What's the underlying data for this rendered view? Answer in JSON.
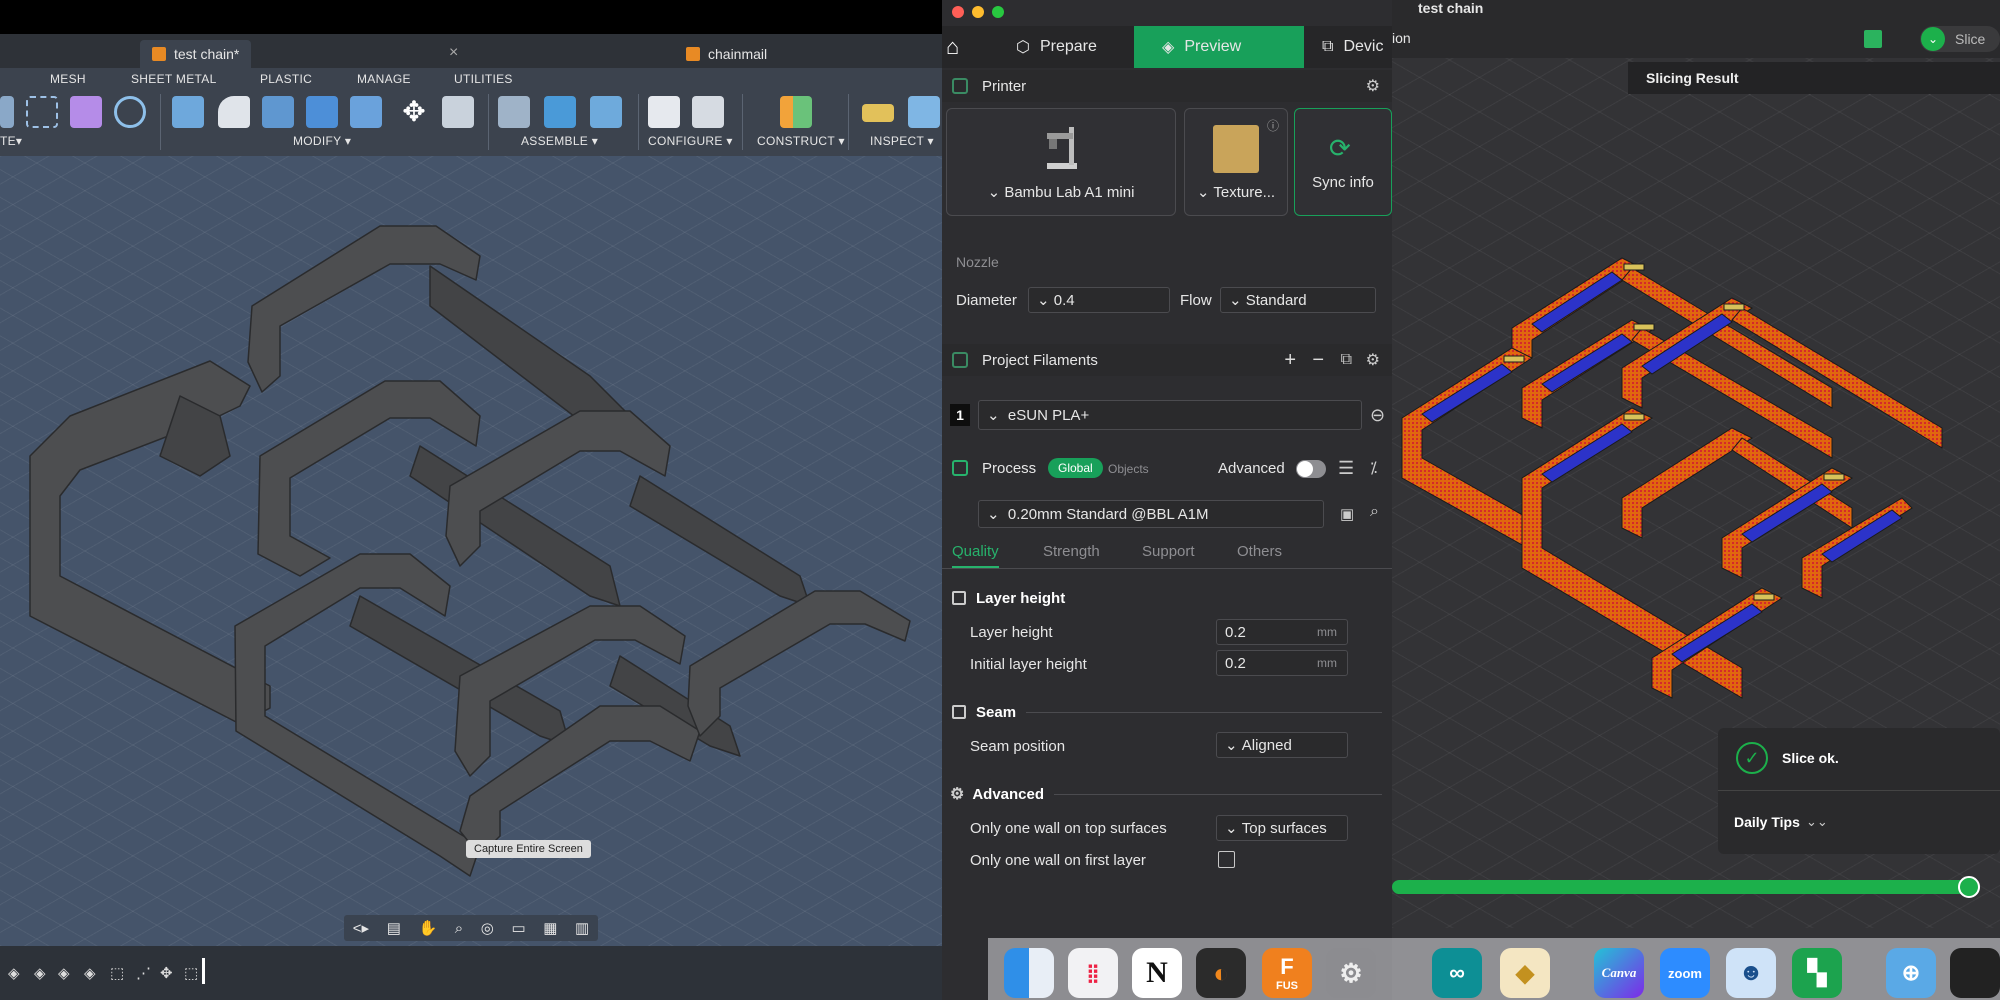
{
  "fusion": {
    "tabs": [
      {
        "label": "test chain*"
      },
      {
        "label": "chainmail"
      }
    ],
    "tab_close": "×",
    "menu": [
      "MESH",
      "SHEET METAL",
      "PLASTIC",
      "MANAGE",
      "UTILITIES"
    ],
    "groups": [
      "TE▾",
      "MODIFY ▾",
      "ASSEMBLE ▾",
      "CONFIGURE ▾",
      "CONSTRUCT ▾",
      "INSPECT ▾"
    ],
    "tooltip": "Capture Entire Screen",
    "nav_icons": [
      "<▸",
      "▤",
      "✋",
      "⌕",
      "◎",
      "▭",
      "▦",
      "▥"
    ],
    "colors": {
      "cube": "#e88a24",
      "model": "#4d4e50",
      "viewport": "#45546a"
    }
  },
  "bambu": {
    "tabs": {
      "prepare": "Prepare",
      "preview": "Preview",
      "device": "Devic"
    },
    "printer": {
      "title": "Printer",
      "model": "Bambu Lab A1 mini",
      "plate": "Texture...",
      "sync": "Sync info"
    },
    "nozzle": {
      "title": "Nozzle",
      "diameter_label": "Diameter",
      "diameter_value": "0.4",
      "flow_label": "Flow",
      "flow_value": "Standard"
    },
    "filaments": {
      "title": "Project Filaments",
      "index": "1",
      "name": "eSUN PLA+"
    },
    "process": {
      "title": "Process",
      "global": "Global",
      "objects": "Objects",
      "advanced": "Advanced",
      "preset": "0.20mm Standard @BBL A1M",
      "tabs": [
        "Quality",
        "Strength",
        "Support",
        "Others"
      ]
    },
    "layer_height": {
      "title": "Layer height",
      "layer_label": "Layer height",
      "layer_value": "0.2",
      "initial_label": "Initial layer height",
      "initial_value": "0.2",
      "unit": "mm"
    },
    "seam": {
      "title": "Seam",
      "position_label": "Seam position",
      "position_value": "Aligned"
    },
    "advanced": {
      "title": "Advanced",
      "one_wall_top_label": "Only one wall on top surfaces",
      "one_wall_top_value": "Top surfaces",
      "one_wall_first_label": "Only one wall on first layer"
    },
    "colors": {
      "accent": "#18a05a"
    }
  },
  "preview": {
    "window_title": "test chain",
    "partial_label": "ion",
    "slice_button": "Slice",
    "slicing_result": "Slicing Result",
    "slice_status": "Slice ok.",
    "daily_tips": "Daily Tips",
    "progress": 1.0,
    "colors": {
      "wall": "#e0680e",
      "infill": "#d42a2a",
      "bridge": "#2c33c9",
      "top": "#d8c25a"
    }
  },
  "dock": {
    "apps": [
      "Finder",
      "Launchpad",
      "Notion",
      "Blender",
      "Fusion",
      "Settings",
      "Arduino",
      "Pineapple",
      "Canva",
      "Zoom",
      "Bot",
      "Bambu",
      "Folder"
    ],
    "fus_label": "FUS",
    "canva_label": "Canva",
    "zoom_label": "zoom"
  }
}
